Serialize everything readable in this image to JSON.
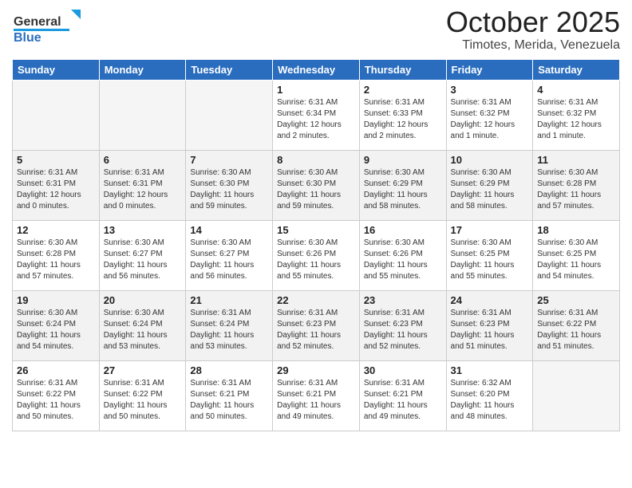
{
  "header": {
    "logo_general": "General",
    "logo_blue": "Blue",
    "month_title": "October 2025",
    "location": "Timotes, Merida, Venezuela"
  },
  "weekdays": [
    "Sunday",
    "Monday",
    "Tuesday",
    "Wednesday",
    "Thursday",
    "Friday",
    "Saturday"
  ],
  "weeks": [
    [
      {
        "day": "",
        "info": ""
      },
      {
        "day": "",
        "info": ""
      },
      {
        "day": "",
        "info": ""
      },
      {
        "day": "1",
        "info": "Sunrise: 6:31 AM\nSunset: 6:34 PM\nDaylight: 12 hours\nand 2 minutes."
      },
      {
        "day": "2",
        "info": "Sunrise: 6:31 AM\nSunset: 6:33 PM\nDaylight: 12 hours\nand 2 minutes."
      },
      {
        "day": "3",
        "info": "Sunrise: 6:31 AM\nSunset: 6:32 PM\nDaylight: 12 hours\nand 1 minute."
      },
      {
        "day": "4",
        "info": "Sunrise: 6:31 AM\nSunset: 6:32 PM\nDaylight: 12 hours\nand 1 minute."
      }
    ],
    [
      {
        "day": "5",
        "info": "Sunrise: 6:31 AM\nSunset: 6:31 PM\nDaylight: 12 hours\nand 0 minutes."
      },
      {
        "day": "6",
        "info": "Sunrise: 6:31 AM\nSunset: 6:31 PM\nDaylight: 12 hours\nand 0 minutes."
      },
      {
        "day": "7",
        "info": "Sunrise: 6:30 AM\nSunset: 6:30 PM\nDaylight: 11 hours\nand 59 minutes."
      },
      {
        "day": "8",
        "info": "Sunrise: 6:30 AM\nSunset: 6:30 PM\nDaylight: 11 hours\nand 59 minutes."
      },
      {
        "day": "9",
        "info": "Sunrise: 6:30 AM\nSunset: 6:29 PM\nDaylight: 11 hours\nand 58 minutes."
      },
      {
        "day": "10",
        "info": "Sunrise: 6:30 AM\nSunset: 6:29 PM\nDaylight: 11 hours\nand 58 minutes."
      },
      {
        "day": "11",
        "info": "Sunrise: 6:30 AM\nSunset: 6:28 PM\nDaylight: 11 hours\nand 57 minutes."
      }
    ],
    [
      {
        "day": "12",
        "info": "Sunrise: 6:30 AM\nSunset: 6:28 PM\nDaylight: 11 hours\nand 57 minutes."
      },
      {
        "day": "13",
        "info": "Sunrise: 6:30 AM\nSunset: 6:27 PM\nDaylight: 11 hours\nand 56 minutes."
      },
      {
        "day": "14",
        "info": "Sunrise: 6:30 AM\nSunset: 6:27 PM\nDaylight: 11 hours\nand 56 minutes."
      },
      {
        "day": "15",
        "info": "Sunrise: 6:30 AM\nSunset: 6:26 PM\nDaylight: 11 hours\nand 55 minutes."
      },
      {
        "day": "16",
        "info": "Sunrise: 6:30 AM\nSunset: 6:26 PM\nDaylight: 11 hours\nand 55 minutes."
      },
      {
        "day": "17",
        "info": "Sunrise: 6:30 AM\nSunset: 6:25 PM\nDaylight: 11 hours\nand 55 minutes."
      },
      {
        "day": "18",
        "info": "Sunrise: 6:30 AM\nSunset: 6:25 PM\nDaylight: 11 hours\nand 54 minutes."
      }
    ],
    [
      {
        "day": "19",
        "info": "Sunrise: 6:30 AM\nSunset: 6:24 PM\nDaylight: 11 hours\nand 54 minutes."
      },
      {
        "day": "20",
        "info": "Sunrise: 6:30 AM\nSunset: 6:24 PM\nDaylight: 11 hours\nand 53 minutes."
      },
      {
        "day": "21",
        "info": "Sunrise: 6:31 AM\nSunset: 6:24 PM\nDaylight: 11 hours\nand 53 minutes."
      },
      {
        "day": "22",
        "info": "Sunrise: 6:31 AM\nSunset: 6:23 PM\nDaylight: 11 hours\nand 52 minutes."
      },
      {
        "day": "23",
        "info": "Sunrise: 6:31 AM\nSunset: 6:23 PM\nDaylight: 11 hours\nand 52 minutes."
      },
      {
        "day": "24",
        "info": "Sunrise: 6:31 AM\nSunset: 6:23 PM\nDaylight: 11 hours\nand 51 minutes."
      },
      {
        "day": "25",
        "info": "Sunrise: 6:31 AM\nSunset: 6:22 PM\nDaylight: 11 hours\nand 51 minutes."
      }
    ],
    [
      {
        "day": "26",
        "info": "Sunrise: 6:31 AM\nSunset: 6:22 PM\nDaylight: 11 hours\nand 50 minutes."
      },
      {
        "day": "27",
        "info": "Sunrise: 6:31 AM\nSunset: 6:22 PM\nDaylight: 11 hours\nand 50 minutes."
      },
      {
        "day": "28",
        "info": "Sunrise: 6:31 AM\nSunset: 6:21 PM\nDaylight: 11 hours\nand 50 minutes."
      },
      {
        "day": "29",
        "info": "Sunrise: 6:31 AM\nSunset: 6:21 PM\nDaylight: 11 hours\nand 49 minutes."
      },
      {
        "day": "30",
        "info": "Sunrise: 6:31 AM\nSunset: 6:21 PM\nDaylight: 11 hours\nand 49 minutes."
      },
      {
        "day": "31",
        "info": "Sunrise: 6:32 AM\nSunset: 6:20 PM\nDaylight: 11 hours\nand 48 minutes."
      },
      {
        "day": "",
        "info": ""
      }
    ]
  ]
}
